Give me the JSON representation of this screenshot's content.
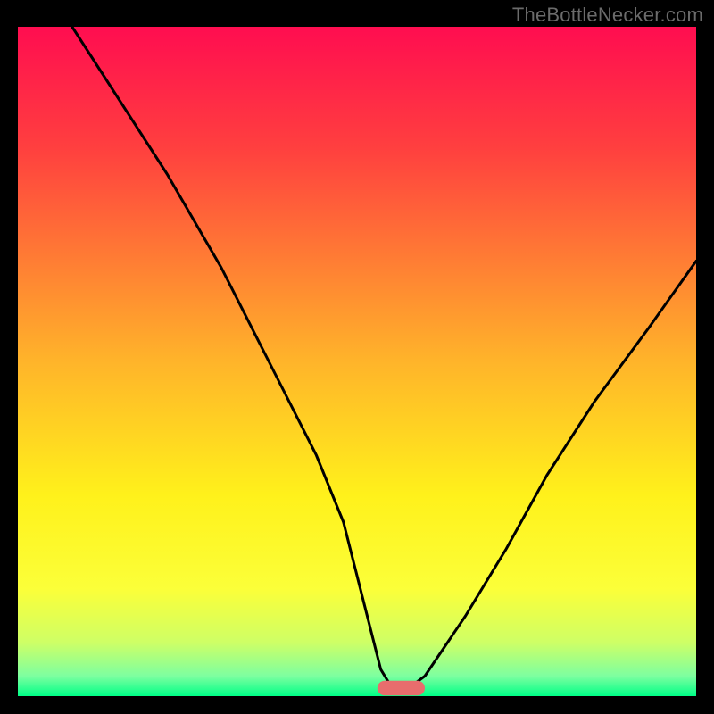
{
  "watermark": "TheBottleNecker.com",
  "chart_data": {
    "type": "line",
    "title": "",
    "xlabel": "",
    "ylabel": "",
    "xlim": [
      0,
      100
    ],
    "ylim": [
      0,
      100
    ],
    "grid": false,
    "legend": false,
    "background_gradient": {
      "stops": [
        {
          "offset": 0,
          "color": "#ff0d50"
        },
        {
          "offset": 18,
          "color": "#ff3f3f"
        },
        {
          "offset": 50,
          "color": "#ffb42a"
        },
        {
          "offset": 70,
          "color": "#fff11b"
        },
        {
          "offset": 84,
          "color": "#fbff39"
        },
        {
          "offset": 92,
          "color": "#ceff66"
        },
        {
          "offset": 97,
          "color": "#7dffa0"
        },
        {
          "offset": 100,
          "color": "#00ff87"
        }
      ]
    },
    "series": [
      {
        "name": "bottleneck-curve",
        "x": [
          8,
          15,
          22,
          30,
          36,
          40,
          44,
          48,
          50,
          52,
          53.5,
          55,
          58,
          60,
          62,
          66,
          72,
          78,
          85,
          93,
          100
        ],
        "y": [
          100,
          89,
          78,
          64,
          52,
          44,
          36,
          26,
          18,
          10,
          4,
          1.5,
          1.5,
          3,
          6,
          12,
          22,
          33,
          44,
          55,
          65
        ]
      }
    ],
    "marker": {
      "shape": "pill",
      "color": "#e86d6d",
      "x_center": 56.5,
      "y": 1.2,
      "width": 7,
      "height": 2.2
    }
  }
}
